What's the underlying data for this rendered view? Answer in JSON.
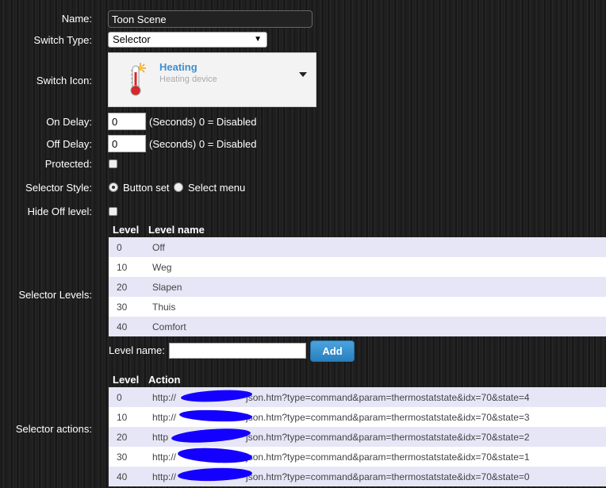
{
  "form": {
    "name_label": "Name:",
    "name_value": "Toon Scene",
    "switch_type_label": "Switch Type:",
    "switch_type_value": "Selector",
    "switch_icon_label": "Switch Icon:",
    "icon_title": "Heating",
    "icon_subtitle": "Heating device",
    "on_delay_label": "On Delay:",
    "on_delay_value": "0",
    "off_delay_label": "Off Delay:",
    "off_delay_value": "0",
    "delay_hint": "(Seconds) 0 = Disabled",
    "protected_label": "Protected:",
    "selector_style_label": "Selector Style:",
    "style_option_button": "Button set",
    "style_option_menu": "Select menu",
    "hide_off_label": "Hide Off level:",
    "selector_levels_label": "Selector Levels:",
    "level_name_label": "Level name:",
    "level_name_value": "",
    "add_label": "Add",
    "selector_actions_label": "Selector actions:"
  },
  "levels_table": {
    "headers": [
      "Level",
      "Level name"
    ],
    "rows": [
      {
        "level": "0",
        "name": "Off"
      },
      {
        "level": "10",
        "name": "Weg"
      },
      {
        "level": "20",
        "name": "Slapen"
      },
      {
        "level": "30",
        "name": "Thuis"
      },
      {
        "level": "40",
        "name": "Comfort"
      }
    ]
  },
  "actions_table": {
    "headers": [
      "Level",
      "Action"
    ],
    "rows": [
      {
        "level": "0",
        "prefix": "http://",
        "suffix": "json.htm?type=command&param=thermostatstate&idx=70&state=4"
      },
      {
        "level": "10",
        "prefix": "http://",
        "suffix": "json.htm?type=command&param=thermostatstate&idx=70&state=3"
      },
      {
        "level": "20",
        "prefix": "http",
        "suffix": "json.htm?type=command&param=thermostatstate&idx=70&state=2"
      },
      {
        "level": "30",
        "prefix": "http://",
        "suffix": "json.htm?type=command&param=thermostatstate&idx=70&state=1"
      },
      {
        "level": "40",
        "prefix": "http://",
        "suffix": "json.htm?type=command&param=thermostatstate&idx=70&state=0"
      }
    ]
  },
  "icons": {
    "switch_icon": "thermometer-sun-icon",
    "redaction": "redaction-scribble"
  },
  "colors": {
    "accent": "#3d8fd1",
    "row_odd": "#e6e6f7",
    "redaction": "#1400ff"
  }
}
